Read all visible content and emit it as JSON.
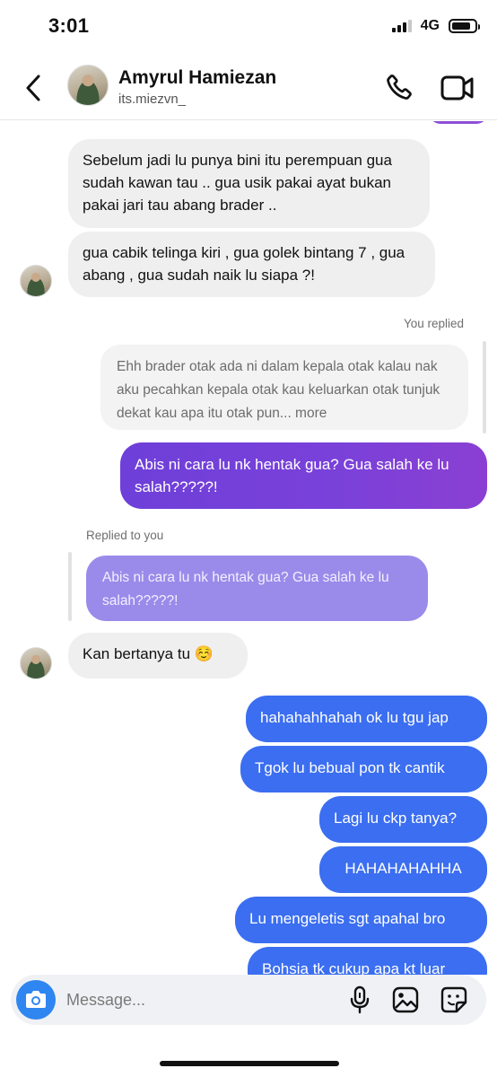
{
  "status_bar": {
    "time": "3:01",
    "network": "4G"
  },
  "header": {
    "name": "Amyrul Hamiezan",
    "username": "its.miezvn_"
  },
  "messages": {
    "incoming_1": "Sebelum jadi lu punya bini itu perempuan gua sudah kawan tau .. gua usik pakai ayat bukan pakai jari tau abang brader ..",
    "incoming_2": "gua cabik telinga kiri , gua golek bintang 7 , gua abang , gua sudah naik lu siapa ?!",
    "you_replied_label": "You replied",
    "quoted_their_message": "Ehh brader otak ada ni dalam kepala otak kalau nak aku pecahkan kepala otak kau keluarkan otak tunjuk dekat kau apa itu otak pun... more",
    "my_reply": "Abis ni cara lu nk hentak gua? Gua salah ke lu salah?????!",
    "replied_to_you_label": "Replied to you",
    "quoted_my_message": "Abis ni cara lu nk hentak gua? Gua salah ke lu salah?????!",
    "incoming_3": "Kan bertanya tu ☺️",
    "outgoing": [
      "hahahahhahah ok lu tgu jap",
      "Tgok lu bebual pon tk cantik",
      "Lagi lu ckp tanya?",
      "HAHAHAHAHHA",
      "Lu mengeletis sgt apahal bro",
      "Bohsia tk cukup apa kt luar"
    ]
  },
  "composer": {
    "placeholder": "Message..."
  },
  "colors": {
    "outgoing_blue": "#3b6ef0",
    "outgoing_purple": "#7a41d9",
    "incoming_gray": "#efefef",
    "camera_blue": "#2f86f0"
  },
  "icons": {
    "back": "chevron-left-icon",
    "call": "phone-icon",
    "video": "video-camera-icon",
    "camera": "camera-icon",
    "mic": "microphone-icon",
    "gallery": "image-icon",
    "sticker": "sticker-icon"
  }
}
